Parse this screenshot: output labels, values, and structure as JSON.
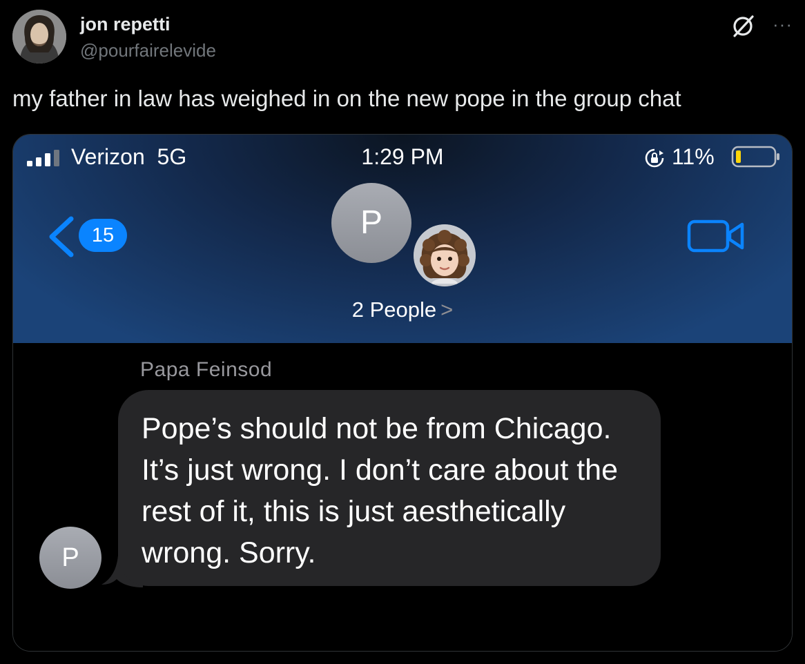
{
  "post": {
    "author_name": "jon repetti",
    "author_handle": "@pourfairelevide",
    "text": "my father in law has weighed in on the new pope in the group chat",
    "more_label": "···"
  },
  "phone": {
    "status_bar": {
      "carrier": "Verizon  5G",
      "time": "1:29 PM",
      "battery": "11%"
    },
    "header": {
      "back_count": "15",
      "group_initial": "P",
      "people_label": "2 People",
      "chevron": ">"
    },
    "thread": {
      "sender_name": "Papa Feinsod",
      "message": "Pope’s should not be from Chicago. It’s just wrong. I don’t care about the rest of it, this is just aesthetically wrong. Sorry.",
      "sender_initial": "P"
    }
  },
  "colors": {
    "imessage_blue": "#0a84ff",
    "bubble_gray": "#262628",
    "handle_gray": "#71767b"
  },
  "icons": [
    "grok-icon",
    "more-icon",
    "signal-icon",
    "lock-rotation-icon",
    "battery-icon",
    "back-chevron-icon",
    "video-camera-icon",
    "memoji-avatar"
  ]
}
